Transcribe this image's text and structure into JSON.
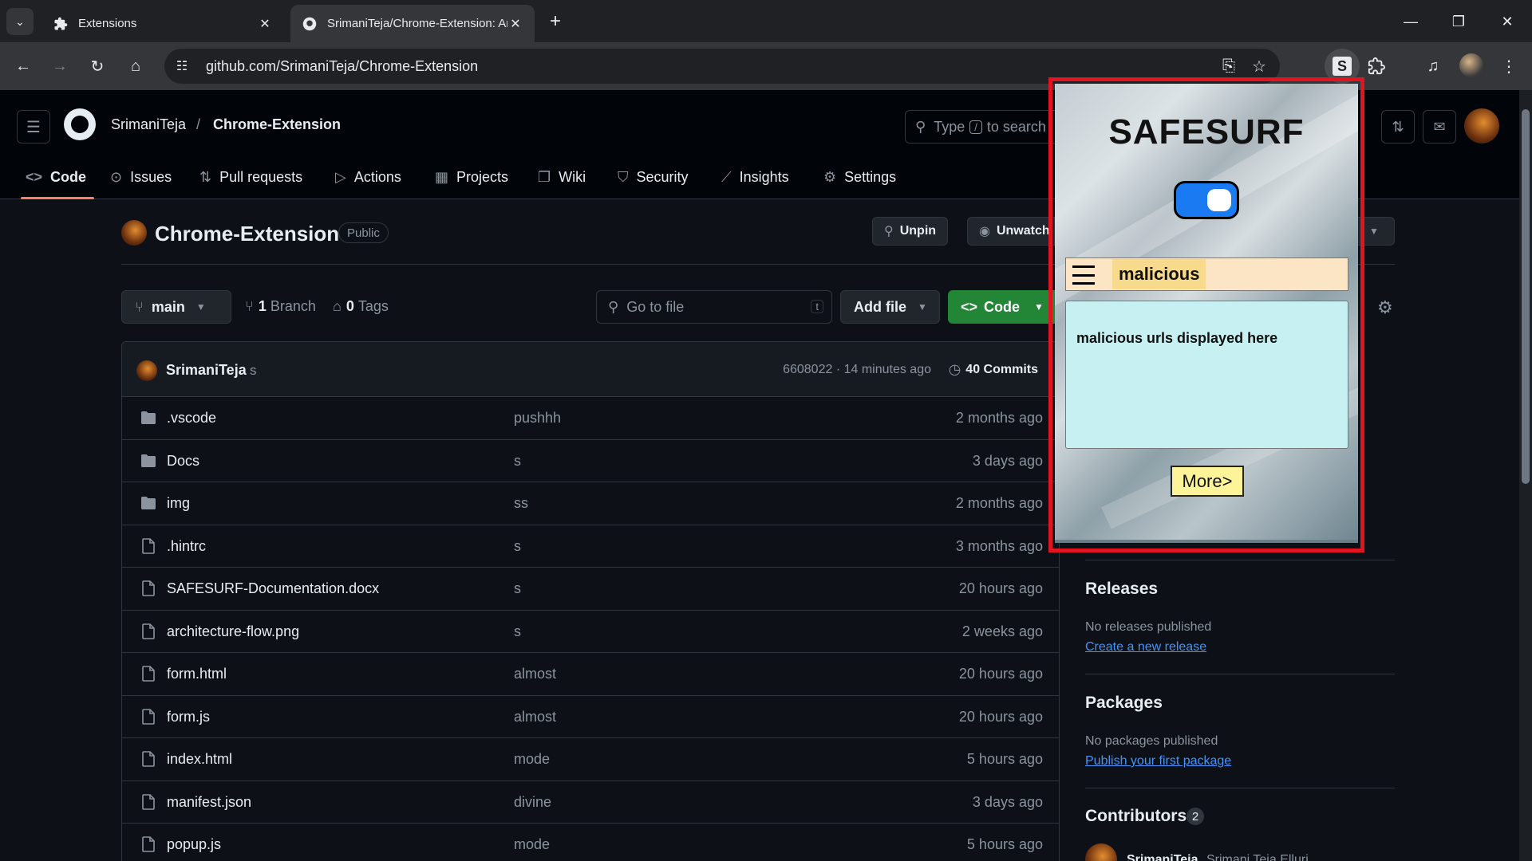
{
  "browser": {
    "tabs": [
      {
        "title": "Extensions",
        "icon": "puzzle-icon",
        "active": false
      },
      {
        "title": "SrimaniTeja/Chrome-Extension: An",
        "icon": "github-icon",
        "active": true
      }
    ],
    "url": "github.com/SrimaniTeja/Chrome-Extension",
    "extension_badge": "S"
  },
  "github": {
    "owner": "SrimaniTeja",
    "separator": "/",
    "repo": "Chrome-Extension",
    "search_prefix": "Type",
    "search_key": "/",
    "search_suffix": "to search",
    "nav": [
      {
        "label": "Code",
        "icon": "code-icon"
      },
      {
        "label": "Issues",
        "icon": "issue-icon"
      },
      {
        "label": "Pull requests",
        "icon": "pull-request-icon"
      },
      {
        "label": "Actions",
        "icon": "play-icon"
      },
      {
        "label": "Projects",
        "icon": "table-icon"
      },
      {
        "label": "Wiki",
        "icon": "book-icon"
      },
      {
        "label": "Security",
        "icon": "shield-icon"
      },
      {
        "label": "Insights",
        "icon": "graph-icon"
      },
      {
        "label": "Settings",
        "icon": "gear-icon"
      }
    ],
    "repo_title": "Chrome-Extension",
    "visibility": "Public",
    "unpin_label": "Unpin",
    "unwatch_label": "Unwatch",
    "branch": "main",
    "branches_count": "1",
    "branches_label": "Branch",
    "tags_count": "0",
    "tags_label": "Tags",
    "goto_file_placeholder": "Go to file",
    "goto_file_key": "t",
    "add_file_label": "Add file",
    "code_label": "Code",
    "last_commit": {
      "author": "SrimaniTeja",
      "message": "s",
      "meta": "6608022 · 14 minutes ago",
      "commits_count": "40",
      "commits_label": "Commits"
    },
    "files": [
      {
        "name": ".vscode",
        "type": "folder",
        "message": "pushhh",
        "time": "2 months ago"
      },
      {
        "name": "Docs",
        "type": "folder",
        "message": "s",
        "time": "3 days ago"
      },
      {
        "name": "img",
        "type": "folder",
        "message": "ss",
        "time": "2 months ago"
      },
      {
        "name": ".hintrc",
        "type": "file",
        "message": "s",
        "time": "3 months ago"
      },
      {
        "name": "SAFESURF-Documentation.docx",
        "type": "file",
        "message": "s",
        "time": "20 hours ago"
      },
      {
        "name": "architecture-flow.png",
        "type": "file",
        "message": "s",
        "time": "2 weeks ago"
      },
      {
        "name": "form.html",
        "type": "file",
        "message": "almost",
        "time": "20 hours ago"
      },
      {
        "name": "form.js",
        "type": "file",
        "message": "almost",
        "time": "20 hours ago"
      },
      {
        "name": "index.html",
        "type": "file",
        "message": "mode",
        "time": "5 hours ago"
      },
      {
        "name": "manifest.json",
        "type": "file",
        "message": "divine",
        "time": "3 days ago"
      },
      {
        "name": "popup.js",
        "type": "file",
        "message": "mode",
        "time": "5 hours ago"
      }
    ],
    "sidebar": {
      "releases_title": "Releases",
      "releases_empty": "No releases published",
      "releases_link": "Create a new release",
      "packages_title": "Packages",
      "packages_empty": "No packages published",
      "packages_link": "Publish your first package",
      "contributors_title": "Contributors",
      "contributors_count": "2",
      "contributor_name_partial": "SrimaniTeja",
      "contributor_full_partial": "Srimani Teja Elluri..."
    }
  },
  "popup": {
    "title": "SAFESURF",
    "toggle_on": true,
    "active_tab": "malicious",
    "panel_text": "malicious urls displayed here",
    "more_label": "More>",
    "highlight_color": "#e0151f"
  }
}
